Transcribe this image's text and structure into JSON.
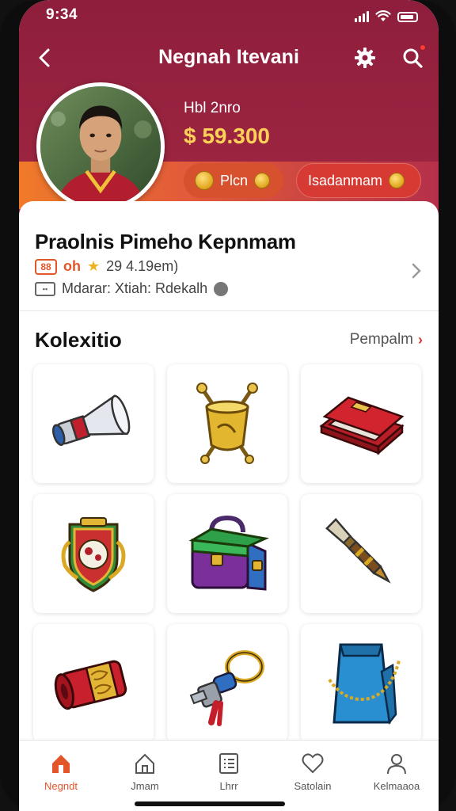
{
  "status_bar": {
    "time": "9:34"
  },
  "nav": {
    "title": "Negnah Itevani",
    "has_notification": true
  },
  "user": {
    "subtitle": "Hbl 2nro",
    "balance": "$ 59.300",
    "plan_label": "Plcn",
    "second_label": "Isadanmam"
  },
  "profile": {
    "name": "Praolnis Pimeho Kepnmam",
    "level_badge": "88",
    "level_text": "oh",
    "count": "29 4.19em)",
    "location": "Mdarar: Xtiah: Rdekalh"
  },
  "collection": {
    "title": "Kolexitio",
    "see_all": "Pempalm",
    "items": [
      {
        "icon": "telescope-icon"
      },
      {
        "icon": "trophy-cup-icon"
      },
      {
        "icon": "wallet-icon"
      },
      {
        "icon": "shield-crest-icon"
      },
      {
        "icon": "backpack-icon"
      },
      {
        "icon": "pen-icon"
      },
      {
        "icon": "scarf-roll-icon"
      },
      {
        "icon": "keychain-icon"
      },
      {
        "icon": "tote-bag-icon"
      }
    ]
  },
  "bottom_nav": {
    "active": "home",
    "items": [
      {
        "label": "Negndt",
        "icon": "home-icon"
      },
      {
        "label": "Jmam",
        "icon": "house-outline-icon"
      },
      {
        "label": "Lhrr",
        "icon": "list-icon"
      },
      {
        "label": "Satolain",
        "icon": "heart-icon"
      },
      {
        "label": "Kelmaaoa",
        "icon": "person-icon"
      }
    ]
  },
  "colors": {
    "header": "#8e1e3c",
    "accent_orange": "#e2562a",
    "balance_gold": "#ffd257",
    "active_nav": "#e2562a"
  }
}
